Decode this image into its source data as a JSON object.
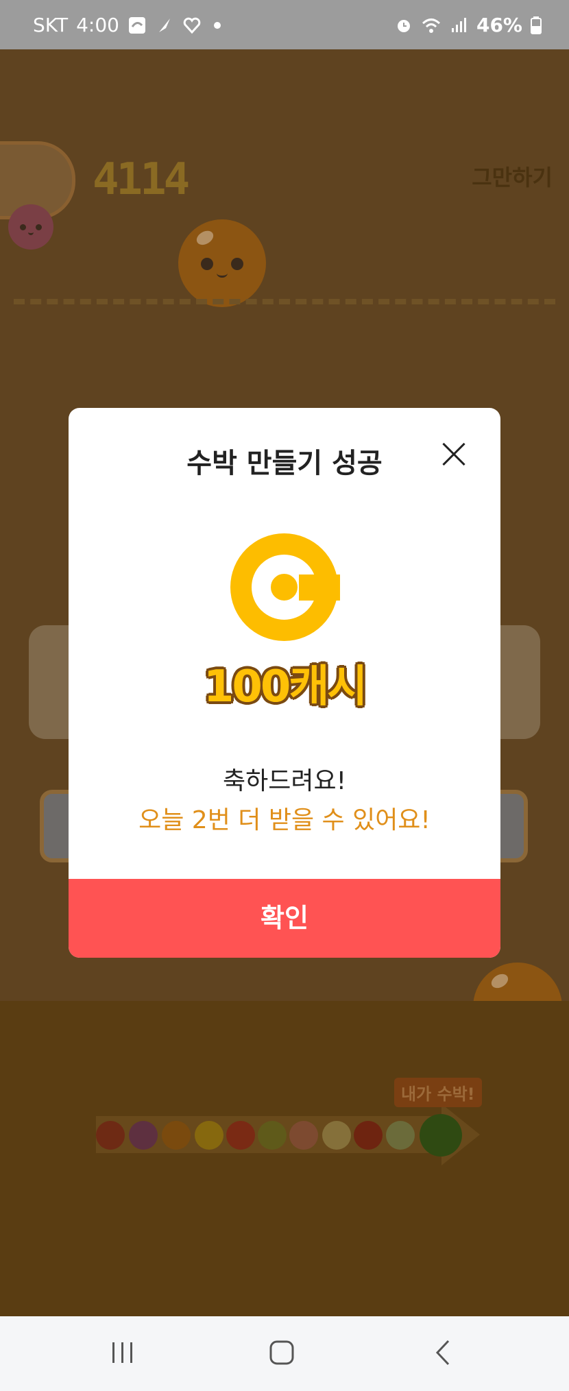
{
  "status_bar": {
    "carrier": "SKT",
    "time": "4:00",
    "battery": "46%"
  },
  "game": {
    "score": "4114",
    "quit_label": "그만하기",
    "evolution_label": "내가 수박!",
    "evolution_fruits": [
      "cherry",
      "grape",
      "tangerine",
      "lemon",
      "tomato",
      "kiwi",
      "peach",
      "pear",
      "apple",
      "melon",
      "watermelon"
    ]
  },
  "dialog": {
    "title": "수박 만들기 성공",
    "reward": "100캐시",
    "message": "축하드려요!",
    "sub_message": "오늘 2번 더 받을 수 있어요!",
    "confirm_label": "확인"
  },
  "colors": {
    "accent_button": "#ff5353",
    "coin": "#fdbd00",
    "highlight_text": "#e08f1a"
  }
}
